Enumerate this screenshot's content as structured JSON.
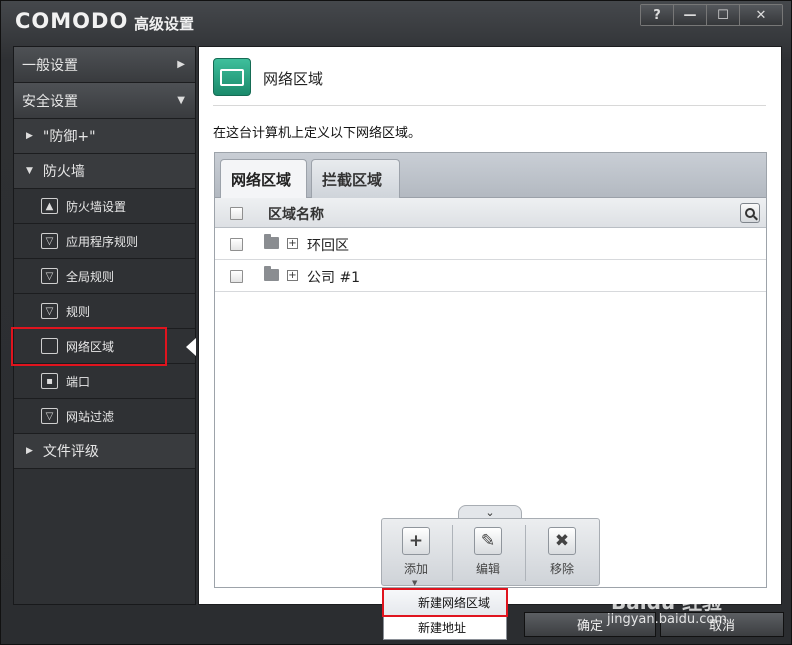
{
  "titlebar": {
    "logo": "COMODO",
    "title": "高级设置",
    "help": "?",
    "minimize": "—",
    "maximize": "☐",
    "close": "✕"
  },
  "sidebar": {
    "general": "一般设置",
    "security": "安全设置",
    "defense": "\"防御+\"",
    "firewall": "防火墙",
    "items": [
      {
        "label": "防火墙设置",
        "icon": "flame"
      },
      {
        "label": "应用程序规则",
        "icon": "filter"
      },
      {
        "label": "全局规则",
        "icon": "monitor-filter"
      },
      {
        "label": "规则",
        "icon": "filter"
      },
      {
        "label": "网络区域",
        "icon": "monitor"
      },
      {
        "label": "端口",
        "icon": "port"
      },
      {
        "label": "网站过滤",
        "icon": "filter"
      }
    ],
    "file_rating": "文件评级"
  },
  "main": {
    "title": "网络区域",
    "description": "在这台计算机上定义以下网络区域。",
    "tabs": [
      "网络区域",
      "拦截区域"
    ],
    "column_header": "区域名称",
    "rows": [
      "环回区",
      "公司 #1"
    ]
  },
  "toolbar": {
    "add": "添加",
    "edit": "编辑",
    "remove": "移除",
    "collapse": "⌄",
    "add_icon": "+",
    "edit_icon": "✎",
    "remove_icon": "✖"
  },
  "dropdown": {
    "items": [
      "新建网络区域",
      "新建地址"
    ]
  },
  "footer": {
    "ok": "确定",
    "cancel": "取消"
  },
  "watermark": {
    "line1": "Baidu 经验",
    "line2": "jingyan.baidu.com"
  },
  "colors": {
    "accent_green": "#1b8a6b",
    "highlight_red": "#e0141e"
  }
}
